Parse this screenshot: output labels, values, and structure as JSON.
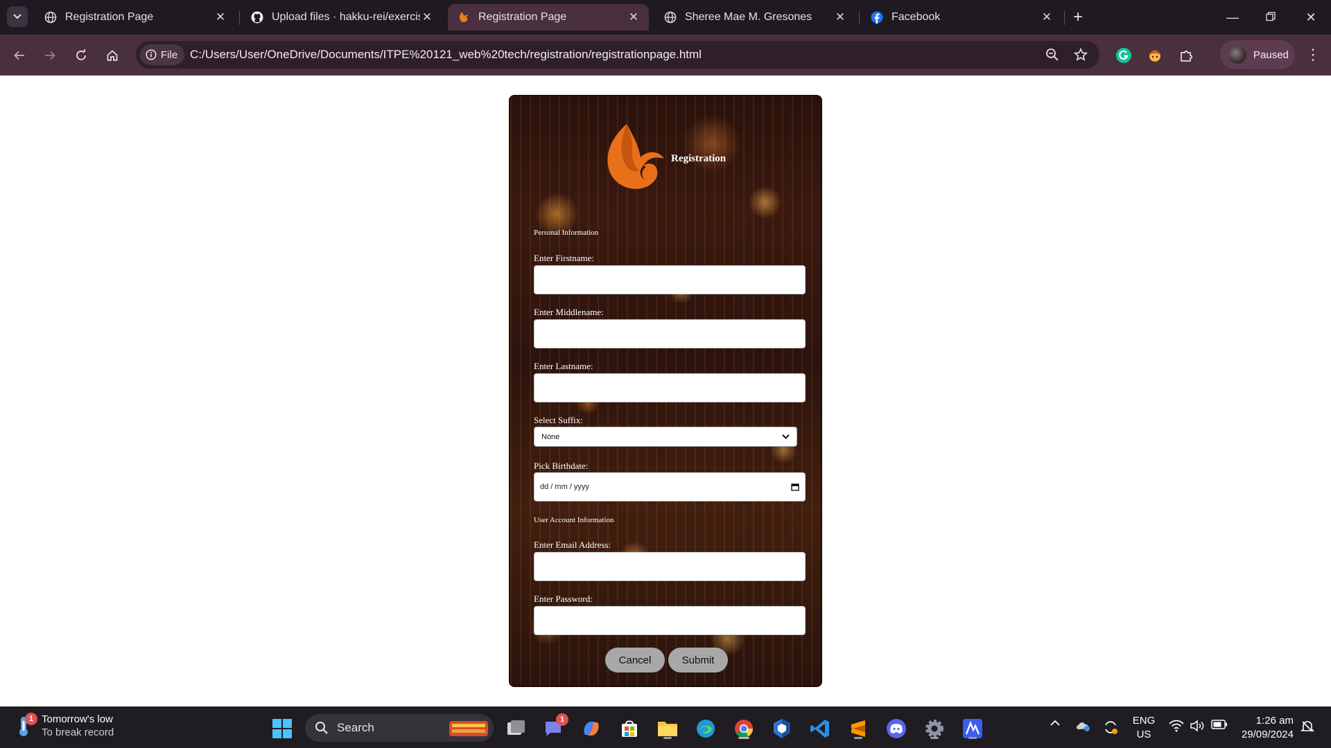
{
  "browser": {
    "tabs": [
      {
        "title": "Registration Page",
        "icon": "globe-icon",
        "active": false
      },
      {
        "title": "Upload files · hakku-rei/exercise",
        "icon": "github-icon",
        "active": false
      },
      {
        "title": "Registration Page",
        "icon": "fox-icon",
        "active": true
      },
      {
        "title": "Sheree Mae M. Gresones",
        "icon": "globe-icon",
        "active": false
      },
      {
        "title": "Facebook",
        "icon": "facebook-icon",
        "active": false
      }
    ],
    "site_chip": "File",
    "url": "C:/Users/User/OneDrive/Documents/ITPE%20121_web%20tech/registration/registrationpage.html",
    "profile_label": "Paused"
  },
  "form": {
    "title": "Registration",
    "personal_section": "Personal Information",
    "firstname_label": "Enter Firstname:",
    "firstname_value": "",
    "middlename_label": "Enter Middlename:",
    "middlename_value": "",
    "lastname_label": "Enter Lastname:",
    "lastname_value": "",
    "suffix_label": "Select Suffix:",
    "suffix_value": "None",
    "birthdate_label": "Pick Birthdate:",
    "birthdate_placeholder": "dd / mm / yyyy",
    "account_section": "User Account Information",
    "email_label": "Enter Email Address:",
    "email_value": "",
    "password_label": "Enter Password:",
    "password_value": "",
    "cancel_label": "Cancel",
    "submit_label": "Submit"
  },
  "taskbar": {
    "weather_title": "Tomorrow's low",
    "weather_subtitle": "To break record",
    "weather_badge": "1",
    "search_label": "Search",
    "teams_badge": "1",
    "lang_top": "ENG",
    "lang_bottom": "US",
    "time": "1:26 am",
    "date": "29/09/2024"
  },
  "colors": {
    "tabstrip_bg": "#1f1a22",
    "toolbar_bg": "#4a2f3d",
    "fox_orange": "#e8701a",
    "button_gray": "#a8a8a8"
  }
}
